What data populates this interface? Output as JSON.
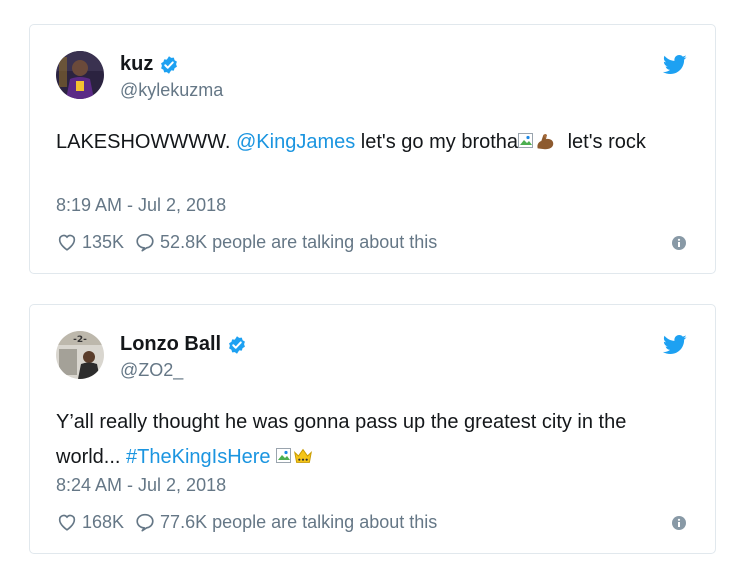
{
  "tweets": [
    {
      "name": "kuz",
      "handle": "@kylekuzma",
      "text_before": "LAKESHOWWWW. ",
      "mention": "@KingJames",
      "text_mid": " let's go my brotha",
      "text_after": " let's rock",
      "timestamp": "8:19 AM - Jul 2, 2018",
      "likes": "135K",
      "replies": "52.8K people are talking about this",
      "emoji": "flexed-biceps"
    },
    {
      "name": "Lonzo Ball",
      "handle": "@ZO2_",
      "text_before": "Y’all really thought he was gonna pass up the greatest city in the world... ",
      "hashtag": "#TheKingIsHere",
      "timestamp": "8:24 AM - Jul 2, 2018",
      "likes": "168K",
      "replies": "77.6K people are talking about this",
      "emoji": "crown"
    }
  ],
  "colors": {
    "verified": "#1da1f2",
    "link": "#1b95e0",
    "meta": "#657786",
    "border": "#e1e8ed"
  },
  "icons": [
    "verified-badge-icon",
    "twitter-bird-icon",
    "heart-icon",
    "reply-bubble-icon",
    "info-icon",
    "broken-image-icon"
  ]
}
